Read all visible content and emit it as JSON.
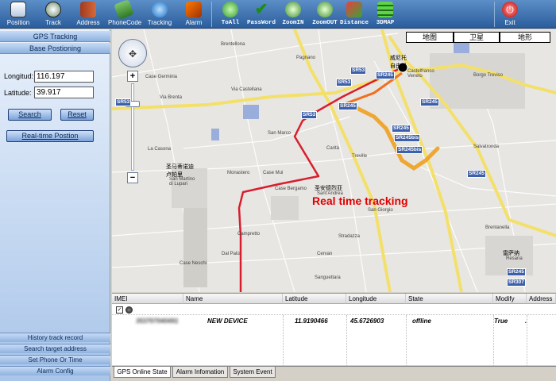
{
  "toolbar": {
    "position": "Position",
    "track": "Track",
    "address": "Address",
    "phonecode": "PhoneCode",
    "tracking": "Tracking",
    "alarm": "Alarm",
    "toall": "ToAll",
    "password": "PassWord",
    "zoomin": "ZoomIN",
    "zoomout": "ZoomOUT",
    "distance": "Distance",
    "map3d": "3DMAP",
    "exit": "Exit"
  },
  "sidebar": {
    "gps_tracking": "GPS Tracking",
    "base_positioning": "Base Postioning",
    "longitude_label": "Longitud:",
    "longitude_value": "116.197",
    "latitude_label": "Latitude:",
    "latitude_value": "39.917",
    "search": "Search",
    "reset": "Reset",
    "realtime": "Real-time Postion",
    "history": "History track record",
    "search_address": "Search target address",
    "set_phone": "Set Phone Or Time",
    "alarm_config": "Alarm Config"
  },
  "map": {
    "types": [
      "地图",
      "卫星",
      "地形"
    ],
    "annotation": "Real time tracking",
    "labels": {
      "venice": "威尼托\n自由堡",
      "castelfranco": "Castelfranco\nVeneto",
      "borgo_treviso": "Borgo Treviso",
      "san_martino_cn": "圣马蒂诺迪\n卢帕里",
      "san_martino": "San Martino\ndi Lupari",
      "santandrea_cn": "圣安德烈亚",
      "santandrea": "Sant'Andrea",
      "resana_cn": "雷萨纳",
      "resana": "Resana",
      "via_brenta": "Via Brenta",
      "via_castellana": "Via Castellana",
      "pagnano": "Pagnano",
      "salvatronda": "Salvatronda",
      "treville": "Treville",
      "monastero": "Monastero",
      "campretto": "Campretto",
      "bergamo": "Case Bergamo",
      "carita": "Carità",
      "san_marco": "San Marco",
      "case_mui": "Case Mui",
      "san_giorgio": "San Giorgio",
      "stradazza": "Stradazza",
      "cervan": "Cervan",
      "sanguettara": "Sanguettara",
      "dal_palu": "Dal Palù",
      "case_neschi": "Case Neschi",
      "brentanella": "Brentanella",
      "brentellona": "Brentellona",
      "la_casona": "La Casona",
      "case_germinia": "Case Germinia"
    },
    "shields": [
      "SR53",
      "SR53",
      "SR53",
      "SR53",
      "SR245",
      "SR245",
      "SR245",
      "SR245",
      "SR245bis",
      "SR245bis",
      "SR245",
      "SR245",
      "SR307"
    ]
  },
  "grid": {
    "headers": [
      "IMEI",
      "Name",
      "Latitude",
      "Longitude",
      "State",
      "Modify",
      "Address"
    ],
    "rows": [
      {
        "imei": "353707040491",
        "name": "NEW DEVICE",
        "latitude": "11.9190466",
        "longitude": "45.6726903",
        "state": "offline",
        "modify": "True",
        "address": "."
      }
    ]
  },
  "tabs": [
    "GPS Online State",
    "Alarm Infomation",
    "System Event"
  ]
}
